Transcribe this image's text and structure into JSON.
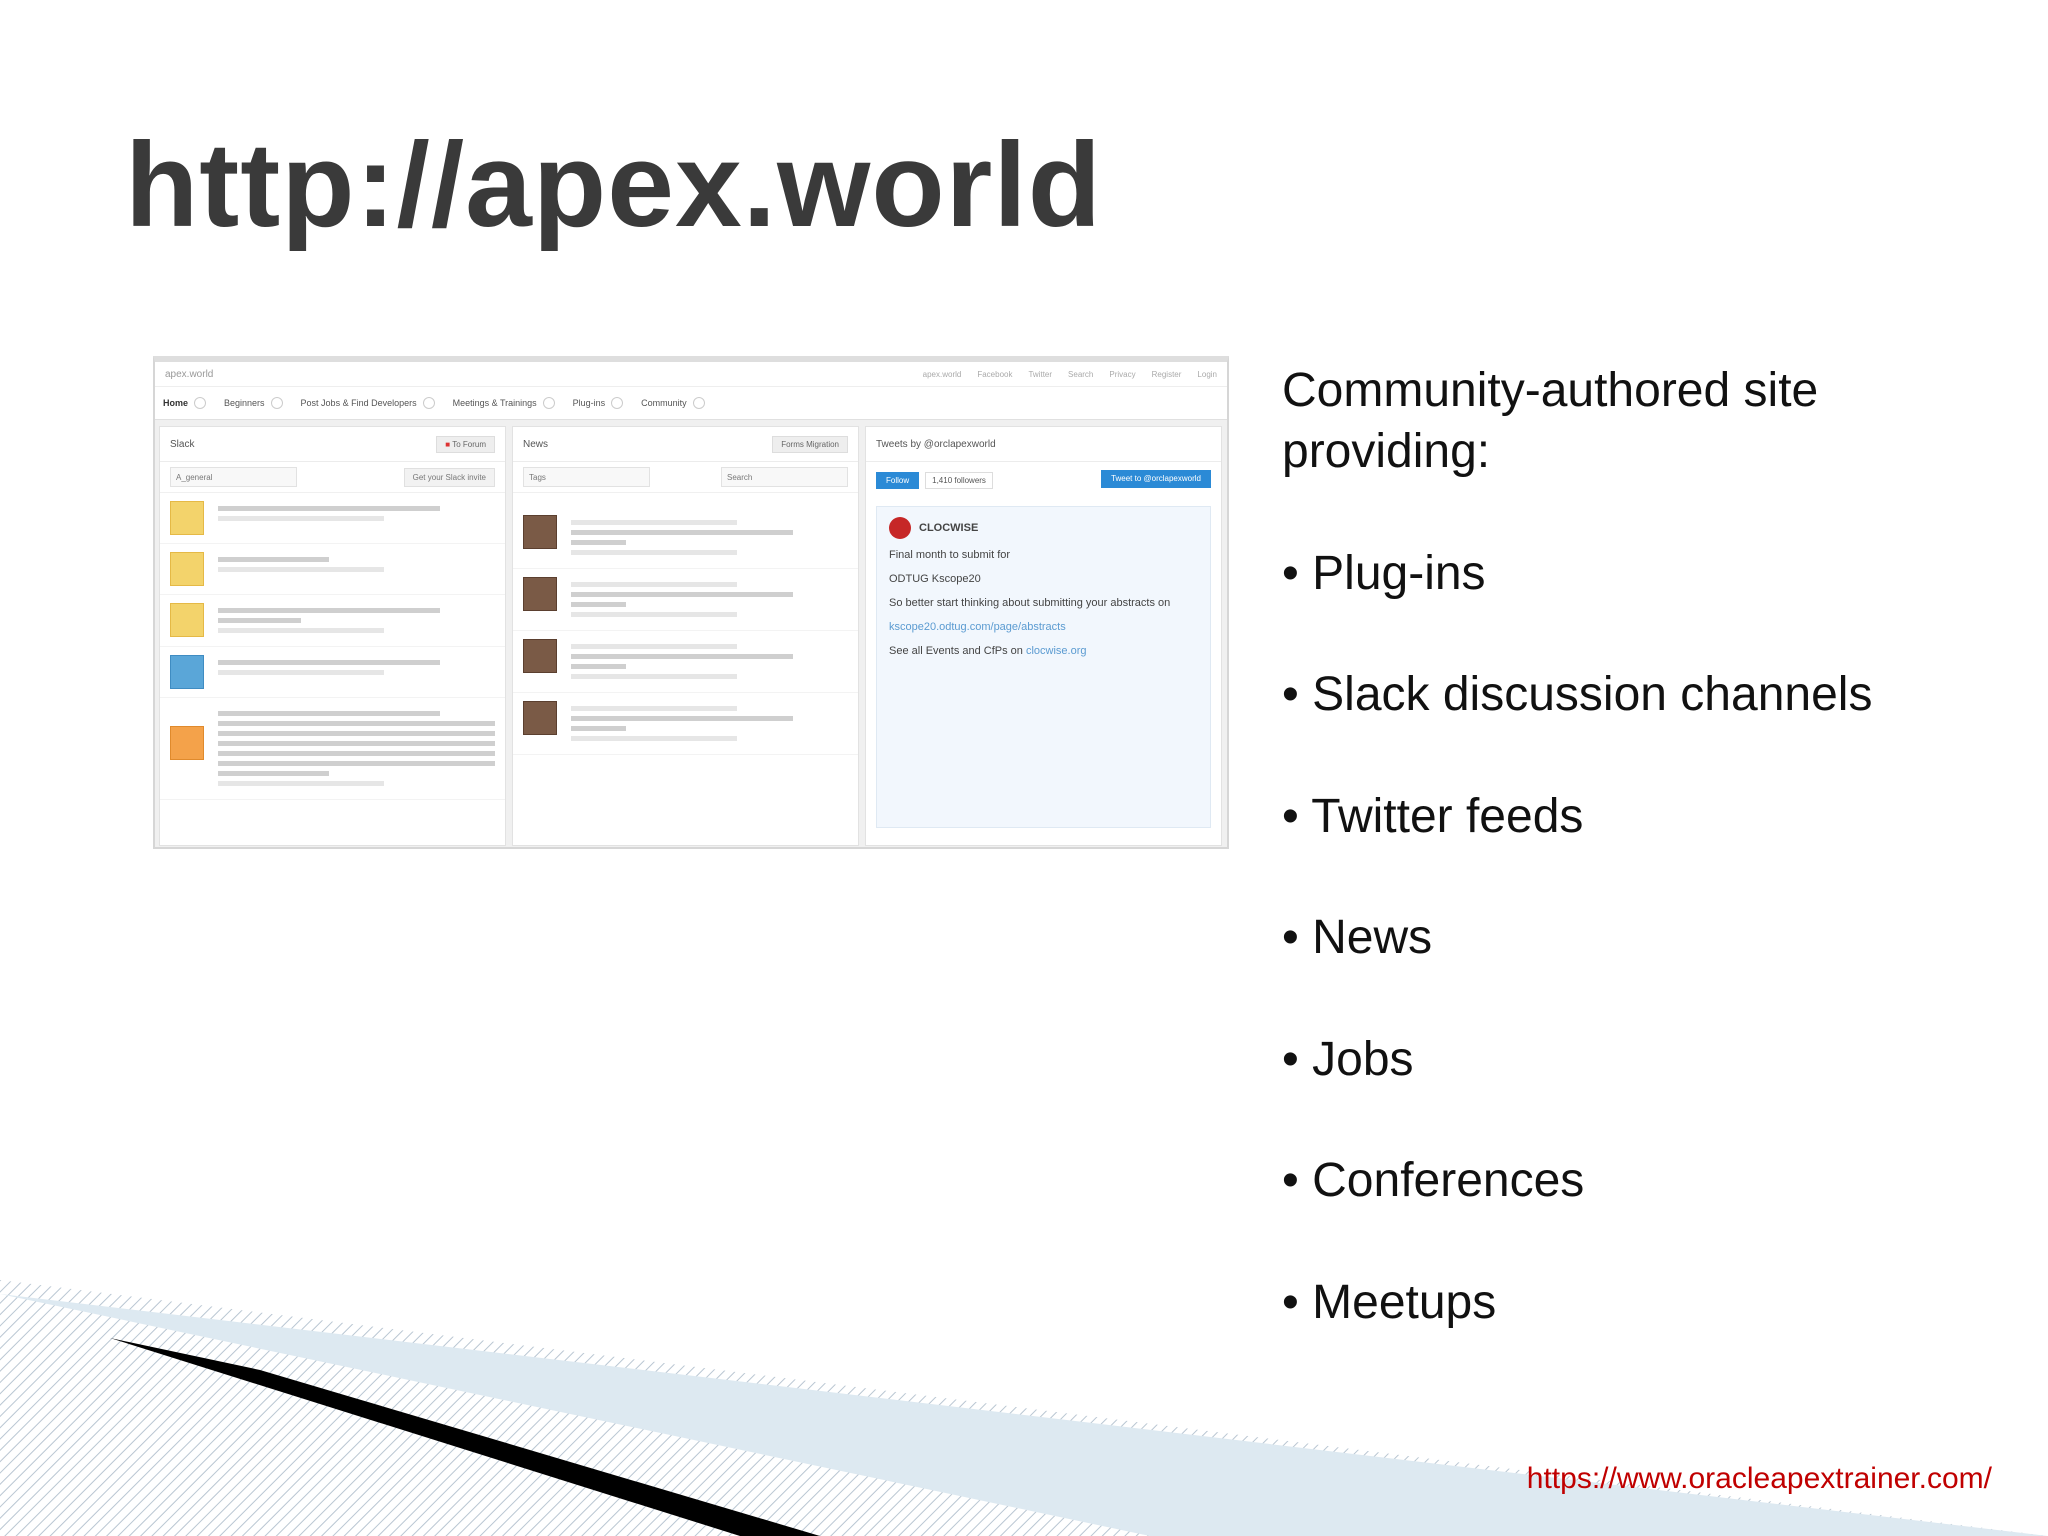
{
  "slide": {
    "title": "http://apex.world",
    "intro": "Community-authored site providing:",
    "bullets": [
      "Plug-ins",
      "Slack discussion channels",
      "Twitter feeds",
      "News",
      "Jobs",
      "Conferences",
      "Meetups"
    ],
    "footer_url": "https://www.oracleapextrainer.com/"
  },
  "screenshot": {
    "brand": "apex.world",
    "top_links": [
      "apex.world",
      "Facebook",
      "Twitter",
      "Search",
      "Privacy",
      "Register",
      "Login"
    ],
    "nav": [
      "Home",
      "Beginners",
      "Post Jobs & Find Developers",
      "Meetings & Trainings",
      "Plug-ins",
      "Community"
    ],
    "slack": {
      "heading": "Slack",
      "button": "To Forum",
      "channel": "A_general",
      "invite": "Get your Slack invite"
    },
    "news": {
      "heading": "News",
      "button": "Forms Migration",
      "filter": "Tags",
      "search": "Search"
    },
    "twitter": {
      "heading": "Tweets by @orclapexworld",
      "follow": "Follow",
      "followers": "1,410 followers",
      "tweet_to": "Tweet to @orclapexworld",
      "author": "CLOCWISE",
      "line1": "Final month to submit for",
      "line2": "ODTUG Kscope20",
      "line3": "So better start thinking about submitting your abstracts on",
      "link": "kscope20.odtug.com/page/abstracts",
      "line4": "See all Events and CfPs on",
      "link2": "clocwise.org"
    }
  }
}
